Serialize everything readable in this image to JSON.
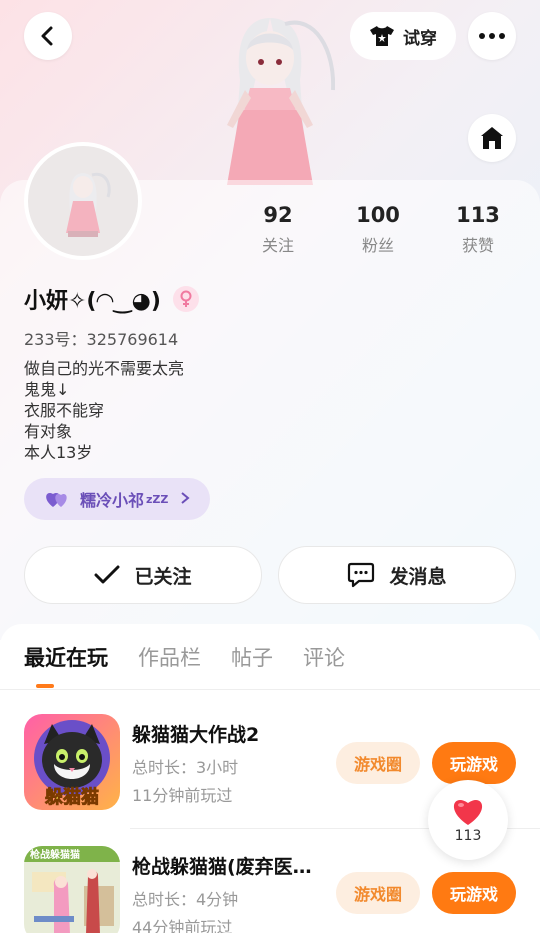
{
  "header": {
    "tryon_label": "试穿"
  },
  "profile": {
    "nickname": "小妍✧(◠‿◕)",
    "id_text": "233号：325769614",
    "bio": [
      "做自己的光不需要太亮",
      "鬼鬼↓",
      "衣服不能穿",
      "有对象",
      "本人13岁"
    ],
    "badge_label": "糯冷小祁",
    "badge_suffix": "zZZ"
  },
  "stats": [
    {
      "value": "92",
      "label": "关注"
    },
    {
      "value": "100",
      "label": "粉丝"
    },
    {
      "value": "113",
      "label": "获赞"
    }
  ],
  "actions": {
    "follow_label": "已关注",
    "message_label": "发消息"
  },
  "tabs": [
    {
      "label": "最近在玩",
      "active": true
    },
    {
      "label": "作品栏",
      "active": false
    },
    {
      "label": "帖子",
      "active": false
    },
    {
      "label": "评论",
      "active": false
    }
  ],
  "games": [
    {
      "title": "躲猫猫大作战2",
      "duration": "总时长：3小时",
      "last_played": "11分钟前玩过",
      "icon_text": "躲猫猫",
      "circle_label": "游戏圈",
      "play_label": "玩游戏"
    },
    {
      "title": "枪战躲猫猫(废弃医…",
      "duration": "总时长：4分钟",
      "last_played": "44分钟前玩过",
      "icon_text": "枪战躲猫猫",
      "circle_label": "游戏圈",
      "play_label": "玩游戏"
    }
  ],
  "like_float": {
    "count": "113"
  },
  "colors": {
    "accent": "#ff7a12",
    "badge_purple": "#6b4fb8",
    "like_red": "#f2364a"
  }
}
